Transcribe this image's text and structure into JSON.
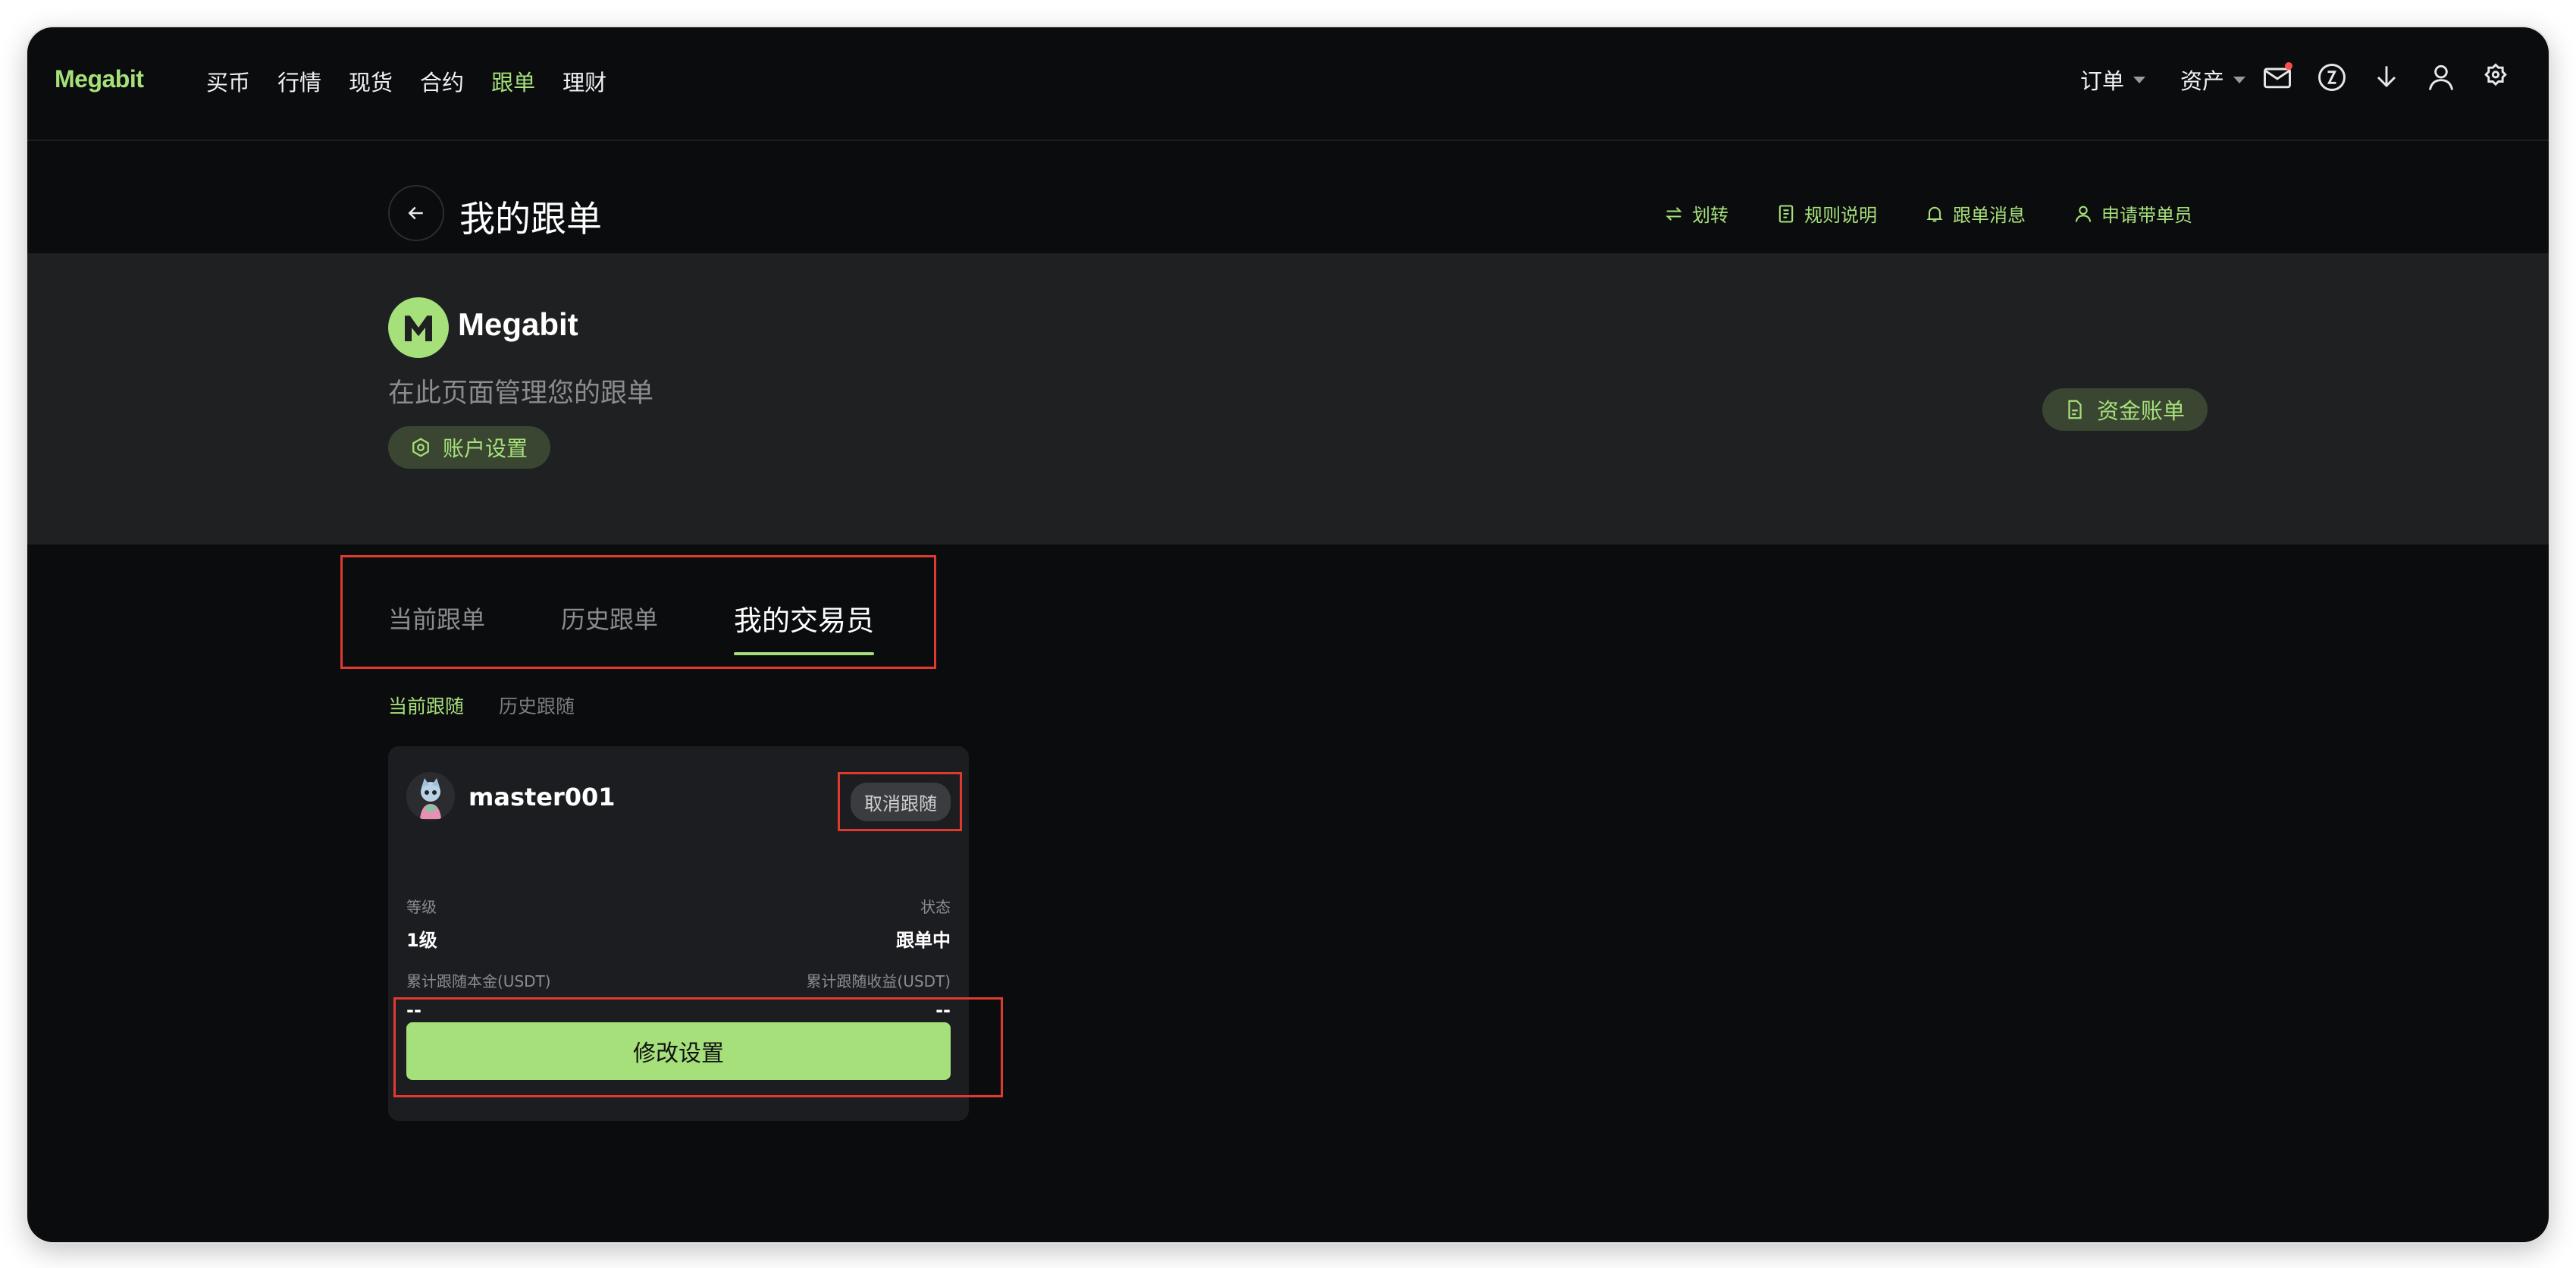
{
  "header": {
    "logo": "Megabit",
    "nav": [
      "买币",
      "行情",
      "现货",
      "合约",
      "跟单",
      "理财"
    ],
    "active_nav": "跟单",
    "orders": "订单",
    "assets": "资产",
    "icons": [
      "mail-icon",
      "language-icon",
      "download-icon",
      "user-icon",
      "settings-icon"
    ]
  },
  "page": {
    "title": "我的跟单",
    "links": {
      "transfer": "划转",
      "rules": "规则说明",
      "messages": "跟单消息",
      "apply": "申请带单员"
    }
  },
  "banner": {
    "brand": "Megabit",
    "subtitle": "在此页面管理您的跟单",
    "account_settings": "账户设置",
    "fund_bill": "资金账单"
  },
  "tabs": {
    "current": "当前跟单",
    "history": "历史跟单",
    "my_traders": "我的交易员",
    "active": "我的交易员"
  },
  "subtabs": {
    "current": "当前跟随",
    "history": "历史跟随",
    "active": "当前跟随"
  },
  "trader_card": {
    "name": "master001",
    "unfollow": "取消跟随",
    "level_label": "等级",
    "level_value": "1级",
    "status_label": "状态",
    "status_value": "跟单中",
    "principal_label": "累计跟随本金(USDT)",
    "principal_value": "--",
    "profit_label": "累计跟随收益(USDT)",
    "profit_value": "--",
    "edit_button": "修改设置"
  },
  "colors": {
    "accent": "#a6e07a",
    "background": "#0b0c0e",
    "banner": "#1f2022",
    "highlight_box": "#e03a2f"
  }
}
